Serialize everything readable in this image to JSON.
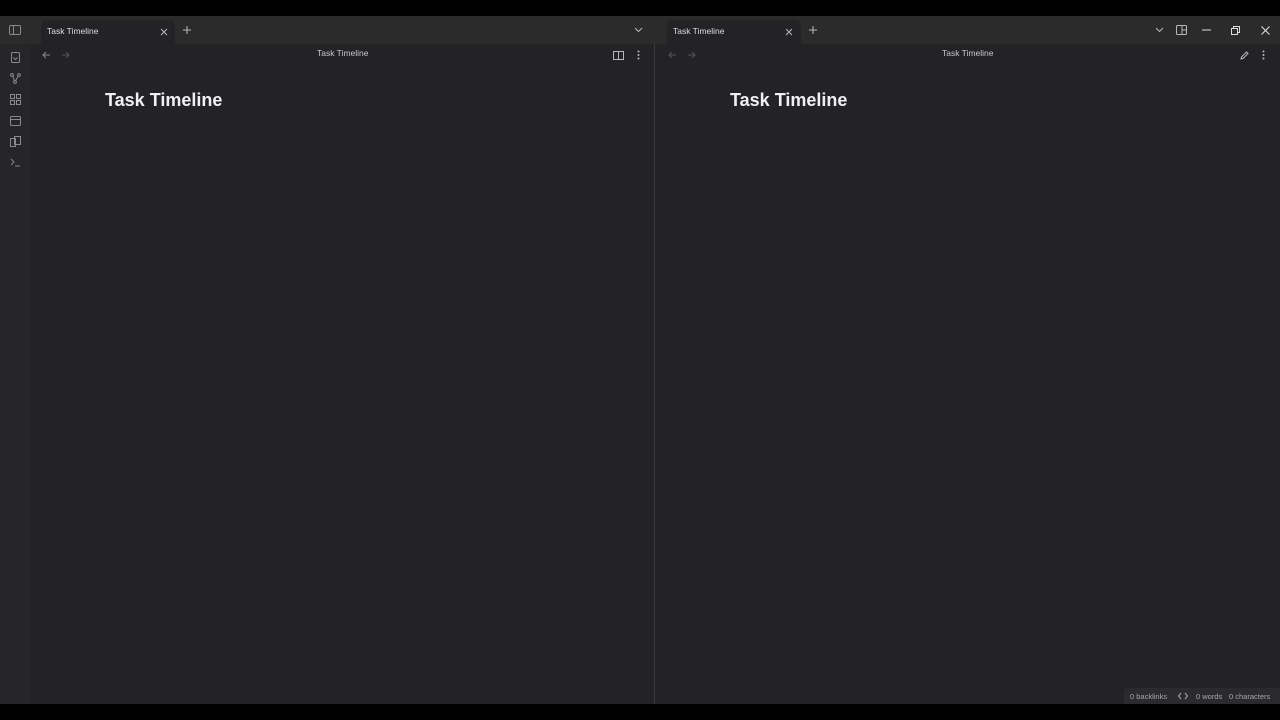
{
  "left_pane": {
    "tab": {
      "label": "Task Timeline"
    },
    "nav": {
      "title": "Task Timeline"
    },
    "doc": {
      "title": "Task Timeline"
    }
  },
  "right_pane": {
    "tab": {
      "label": "Task Timeline"
    },
    "nav": {
      "title": "Task Timeline"
    },
    "doc": {
      "title": "Task Timeline"
    }
  },
  "status_bar": {
    "backlinks": "0 backlinks",
    "words": "0 words",
    "characters": "0 characters"
  },
  "icons": {
    "ribbon": [
      "sidebar-toggle-icon",
      "files-icon",
      "graph-icon",
      "canvas-icon",
      "calendar-icon",
      "templates-icon",
      "terminal-icon"
    ],
    "window": [
      "tab-list-icon",
      "layout-icon",
      "minimize-icon",
      "restore-icon",
      "close-icon"
    ]
  },
  "colors": {
    "background": "#232326",
    "tab_bar": "#2b2b2b",
    "ribbon": "#262629",
    "text": "#dcddde"
  }
}
